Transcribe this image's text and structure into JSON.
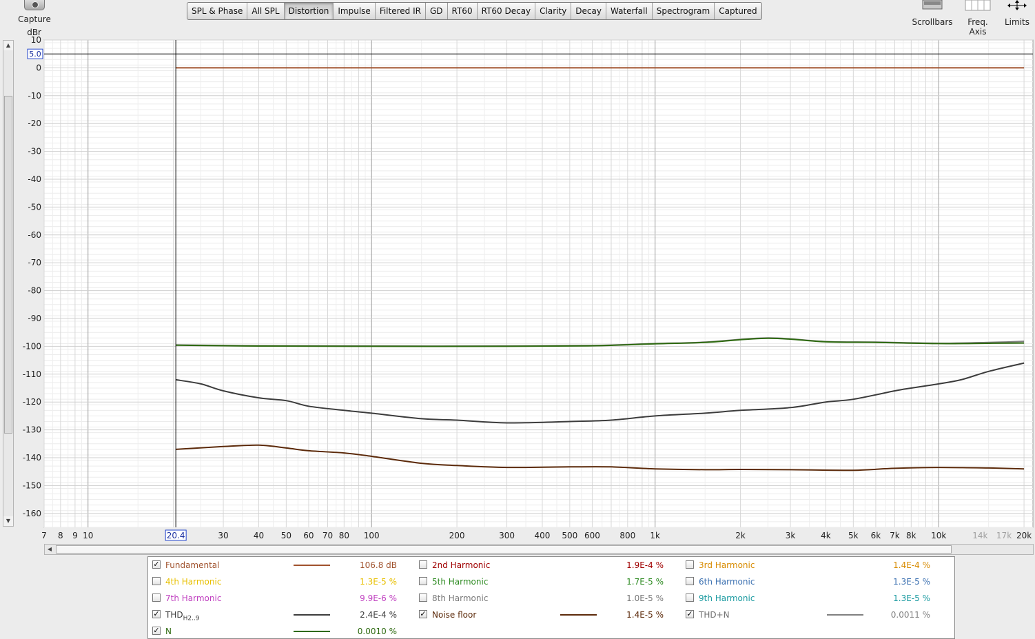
{
  "toolbar": {
    "capture_label": "Capture",
    "tabs": [
      "SPL & Phase",
      "All SPL",
      "Distortion",
      "Impulse",
      "Filtered IR",
      "GD",
      "RT60",
      "RT60 Decay",
      "Clarity",
      "Decay",
      "Waterfall",
      "Spectrogram",
      "Captured"
    ],
    "active_tab": "Distortion",
    "scrollbars_label": "Scrollbars",
    "freq_axis_label": "Freq. Axis",
    "limits_label": "Limits"
  },
  "colors": {
    "fundamental": "#a0522d",
    "h2": "#a00000",
    "h3": "#d88b00",
    "h4": "#e8c000",
    "h5": "#2e8b22",
    "h6": "#3a6fb0",
    "h7": "#c040c0",
    "h8": "#7a7a7a",
    "h9": "#1a9aa0",
    "thd": "#3c3c3c",
    "noise_floor": "#5c2a0a",
    "thdn": "#808080",
    "n": "#2e6a10"
  },
  "chart_data": {
    "type": "line",
    "yunit": "dBr",
    "ylim": [
      -165,
      10
    ],
    "yticks": [
      10,
      0,
      -10,
      -20,
      -30,
      -40,
      -50,
      -60,
      -70,
      -80,
      -90,
      -100,
      -110,
      -120,
      -130,
      -140,
      -150,
      -160
    ],
    "xscale": "log",
    "xlim": [
      7,
      21500
    ],
    "xticks": [
      {
        "v": 7,
        "label": "7"
      },
      {
        "v": 8,
        "label": "8"
      },
      {
        "v": 9,
        "label": "9"
      },
      {
        "v": 10,
        "label": "10"
      },
      {
        "v": 30,
        "label": "30"
      },
      {
        "v": 40,
        "label": "40"
      },
      {
        "v": 50,
        "label": "50"
      },
      {
        "v": 60,
        "label": "60"
      },
      {
        "v": 70,
        "label": "70"
      },
      {
        "v": 80,
        "label": "80"
      },
      {
        "v": 100,
        "label": "100"
      },
      {
        "v": 200,
        "label": "200"
      },
      {
        "v": 300,
        "label": "300"
      },
      {
        "v": 400,
        "label": "400"
      },
      {
        "v": 500,
        "label": "500"
      },
      {
        "v": 600,
        "label": "600"
      },
      {
        "v": 800,
        "label": "800"
      },
      {
        "v": 1000,
        "label": "1k"
      },
      {
        "v": 2000,
        "label": "2k"
      },
      {
        "v": 3000,
        "label": "3k"
      },
      {
        "v": 4000,
        "label": "4k"
      },
      {
        "v": 5000,
        "label": "5k"
      },
      {
        "v": 6000,
        "label": "6k"
      },
      {
        "v": 7000,
        "label": "7k"
      },
      {
        "v": 8000,
        "label": "8k"
      },
      {
        "v": 10000,
        "label": "10k"
      },
      {
        "v": 14000,
        "label": "14k",
        "dim": true
      },
      {
        "v": 17000,
        "label": "17k",
        "dim": true
      },
      {
        "v": 20000,
        "label": "20k"
      }
    ],
    "cursor": {
      "x": 20.4,
      "x_label": "20.4",
      "y": 5.0,
      "y_label": "5.0"
    },
    "series": [
      {
        "name": "Fundamental",
        "color": "#a0522d",
        "x": [
          20.4,
          20000
        ],
        "y": [
          0,
          0
        ]
      },
      {
        "name": "THD+N",
        "color": "#808080",
        "x": [
          20.4,
          40,
          100,
          300,
          600,
          1000,
          1500,
          2500,
          4000,
          6000,
          10000,
          15000,
          20000
        ],
        "y": [
          -99.5,
          -99.8,
          -99.9,
          -99.9,
          -99.7,
          -99.0,
          -98.5,
          -97.0,
          -98.3,
          -98.5,
          -98.9,
          -98.6,
          -98.2
        ]
      },
      {
        "name": "N",
        "color": "#2e6a10",
        "x": [
          20.4,
          40,
          100,
          300,
          600,
          1000,
          1500,
          2500,
          4000,
          6000,
          10000,
          15000,
          20000
        ],
        "y": [
          -99.6,
          -99.9,
          -100.0,
          -100.0,
          -99.8,
          -99.1,
          -98.6,
          -97.1,
          -98.4,
          -98.6,
          -99.0,
          -98.9,
          -98.8
        ]
      },
      {
        "name": "THD",
        "color": "#3c3c3c",
        "x": [
          20.4,
          25,
          30,
          40,
          50,
          60,
          80,
          100,
          150,
          200,
          300,
          500,
          700,
          1000,
          1500,
          2000,
          3000,
          4000,
          5000,
          7000,
          8000,
          10000,
          12000,
          15000,
          20000
        ],
        "y": [
          -112,
          -113.5,
          -116,
          -118.5,
          -119.5,
          -121.5,
          -123,
          -124,
          -126,
          -126.5,
          -127.5,
          -127,
          -126.5,
          -125,
          -124,
          -123,
          -122,
          -120,
          -119,
          -116,
          -115,
          -113.5,
          -112,
          -109,
          -106
        ]
      },
      {
        "name": "Noise floor",
        "color": "#5c2a0a",
        "x": [
          20.4,
          30,
          40,
          50,
          60,
          80,
          100,
          150,
          200,
          300,
          500,
          700,
          1000,
          1500,
          2000,
          3000,
          5000,
          7000,
          10000,
          15000,
          20000
        ],
        "y": [
          -137,
          -136,
          -135.5,
          -136.5,
          -137.5,
          -138.3,
          -139.5,
          -142,
          -142.8,
          -143.5,
          -143.3,
          -143.3,
          -144,
          -144.3,
          -144.2,
          -144.3,
          -144.5,
          -143.8,
          -143.5,
          -143.7,
          -144
        ]
      }
    ]
  },
  "legend": [
    {
      "key": "fundamental",
      "name": "Fundamental",
      "checked": true,
      "swatch": true,
      "value": "106.8 dB"
    },
    {
      "key": "h2",
      "name": "2nd Harmonic",
      "checked": false,
      "swatch": false,
      "value": "1.9E-4 %"
    },
    {
      "key": "h3",
      "name": "3rd Harmonic",
      "checked": false,
      "swatch": false,
      "value": "1.4E-4 %"
    },
    {
      "key": "h4",
      "name": "4th Harmonic",
      "checked": false,
      "swatch": false,
      "value": "1.3E-5 %"
    },
    {
      "key": "h5",
      "name": "5th Harmonic",
      "checked": false,
      "swatch": false,
      "value": "1.7E-5 %"
    },
    {
      "key": "h6",
      "name": "6th Harmonic",
      "checked": false,
      "swatch": false,
      "value": "1.3E-5 %"
    },
    {
      "key": "h7",
      "name": "7th Harmonic",
      "checked": false,
      "swatch": false,
      "value": "9.9E-6 %"
    },
    {
      "key": "h8",
      "name": "8th Harmonic",
      "checked": false,
      "swatch": false,
      "value": "1.0E-5 %"
    },
    {
      "key": "h9",
      "name": "9th Harmonic",
      "checked": false,
      "swatch": false,
      "value": "1.3E-5 %"
    },
    {
      "key": "thd",
      "name": "THD",
      "sub": "H2..9",
      "checked": true,
      "swatch": true,
      "value": "2.4E-4 %"
    },
    {
      "key": "noise_floor",
      "name": "Noise floor",
      "checked": true,
      "swatch": true,
      "value": "1.4E-5 %"
    },
    {
      "key": "thdn",
      "name": "THD+N",
      "checked": true,
      "swatch": true,
      "value": "0.0011 %"
    },
    {
      "key": "n",
      "name": "N",
      "checked": true,
      "swatch": true,
      "value": "0.0010 %"
    }
  ]
}
